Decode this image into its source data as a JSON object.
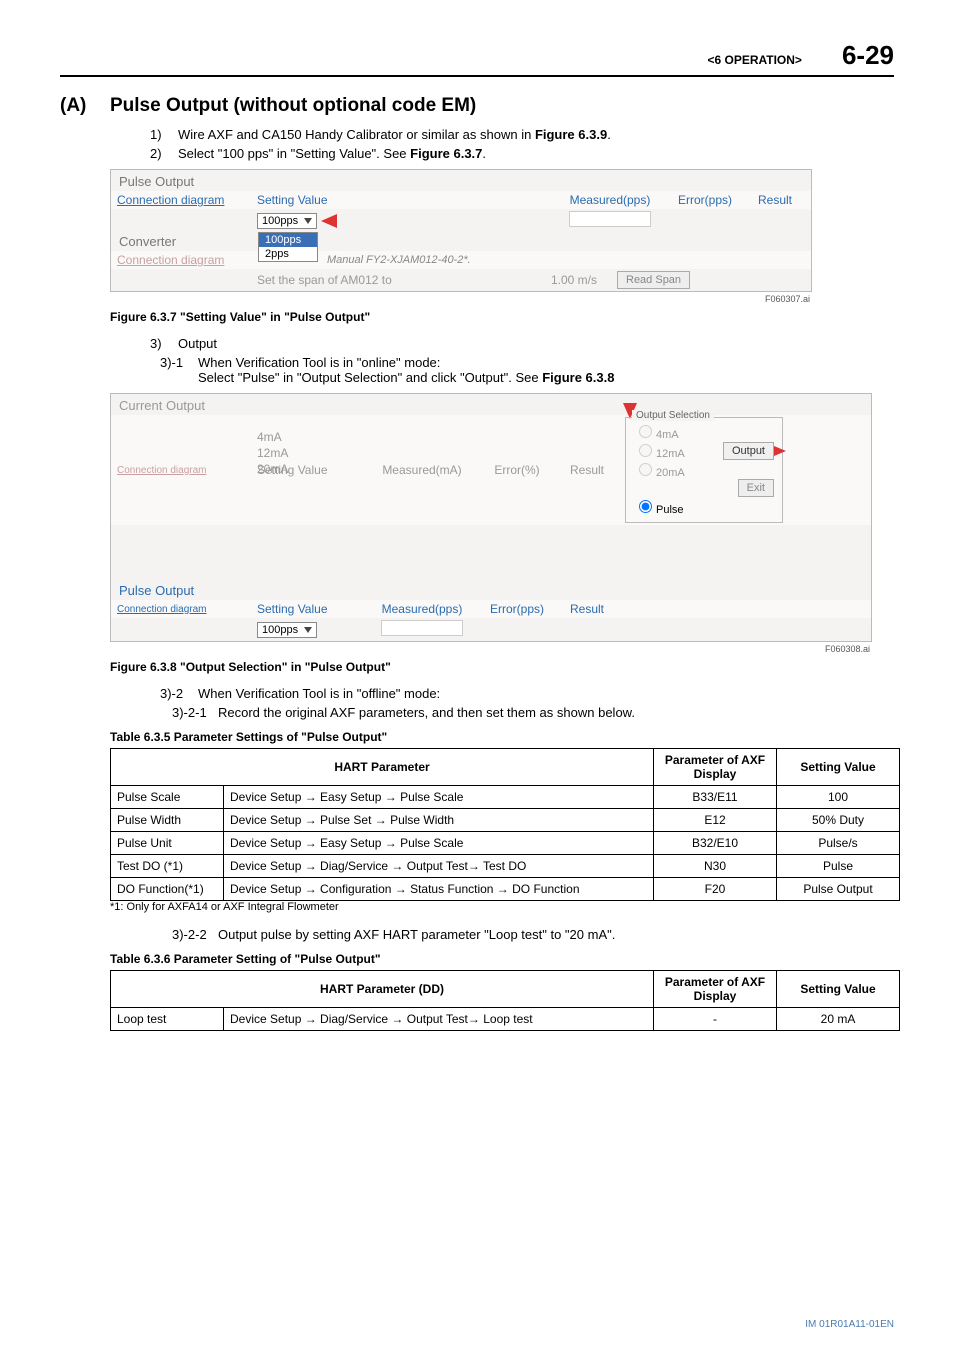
{
  "header": {
    "chapter": "<6  OPERATION>",
    "page": "6-29"
  },
  "section": {
    "marker": "(A)",
    "title": "Pulse Output (without optional code EM)"
  },
  "steps": {
    "s1": "1)",
    "t1a": "Wire AXF and CA150 Handy Calibrator or similar as shown in ",
    "t1b": "Figure 6.3.9",
    "t1c": ".",
    "s2": "2)",
    "t2a": "Select \"100 pps\" in \"Setting Value\". See ",
    "t2b": "Figure 6.3.7",
    "t2c": ".",
    "s3": "3)",
    "t3": "Output",
    "s31": "3)-1",
    "t31a": "When Verification Tool is in \"online\" mode:",
    "t31b": "Select \"Pulse\" in \"Output Selection\" and click \"Output\". See ",
    "t31c": "Figure 6.3.8",
    "s32": "3)-2",
    "t32": "When Verification Tool is in \"offline\" mode:",
    "s321": "3)-2-1",
    "t321": "Record the original AXF parameters, and then set them as shown below.",
    "s322": "3)-2-2",
    "t322": "Output pulse by setting AXF HART parameter \"Loop test\" to \"20 mA\"."
  },
  "fig637": {
    "caption": "Figure 6.3.7 \"Setting Value\" in \"Pulse Output\"",
    "ref": "F060307.ai",
    "title_pulse": "Pulse Output",
    "conn": "Connection diagram",
    "setting_label": "Setting Value",
    "measured": "Measured(pps)",
    "error": "Error(pps)",
    "result": "Result",
    "dd_value": "100pps",
    "dd_opt1": "100pps",
    "dd_opt2": "2pps",
    "converter": "Converter",
    "manual": "Manual FY2-XJAM012-40-2*.",
    "span_text": "Set the span of AM012 to",
    "span_val": "1.00  m/s",
    "read_span": "Read Span"
  },
  "fig638": {
    "caption": "Figure 6.3.8 \"Output Selection\" in \"Pulse Output\"",
    "ref": "F060308.ai",
    "title_current": "Current Output",
    "title_pulse": "Pulse Output",
    "conn": "Connection diagram",
    "setting_label": "Setting Value",
    "measured_ma": "Measured(mA)",
    "error_pct": "Error(%)",
    "result": "Result",
    "v4": "4mA",
    "v12": "12mA",
    "v20": "20mA",
    "measured_pps": "Measured(pps)",
    "error_pps": "Error(pps)",
    "dd_value": "100pps",
    "legend": "Output Selection",
    "r4": "4mA",
    "r12": "12mA",
    "r20": "20mA",
    "rpulse": "Pulse",
    "btn_output": "Output",
    "btn_exit": "Exit"
  },
  "table635": {
    "caption": "Table 6.3.5 Parameter Settings of \"Pulse Output\"",
    "h1": "HART Parameter",
    "h2": "Parameter of AXF Display",
    "h3": "Setting Value",
    "rows": [
      {
        "a": "Pulse Scale",
        "b": "Device Setup → Easy Setup → Pulse Scale",
        "c": "B33/E11",
        "d": "100"
      },
      {
        "a": "Pulse Width",
        "b": "Device Setup → Pulse Set → Pulse Width",
        "c": "E12",
        "d": "50% Duty"
      },
      {
        "a": "Pulse Unit",
        "b": "Device Setup → Easy Setup → Pulse Scale",
        "c": "B32/E10",
        "d": "Pulse/s"
      },
      {
        "a": "Test DO (*1)",
        "b": "Device Setup → Diag/Service → Output Test→ Test DO",
        "c": "N30",
        "d": "Pulse"
      },
      {
        "a": "DO Function(*1)",
        "b": "Device Setup → Configuration → Status Function → DO Function",
        "c": "F20",
        "d": "Pulse Output"
      }
    ],
    "note": "*1: Only for AXFA14 or AXF Integral Flowmeter"
  },
  "table636": {
    "caption": "Table 6.3.6 Parameter Setting of \"Pulse Output\"",
    "h1": "HART Parameter (DD)",
    "h2": "Parameter of AXF Display",
    "h3": "Setting Value",
    "rows": [
      {
        "a": "Loop test",
        "b": "Device Setup → Diag/Service → Output Test→ Loop test",
        "c": "-",
        "d": "20 mA"
      }
    ]
  },
  "footer": "IM 01R01A11-01EN"
}
